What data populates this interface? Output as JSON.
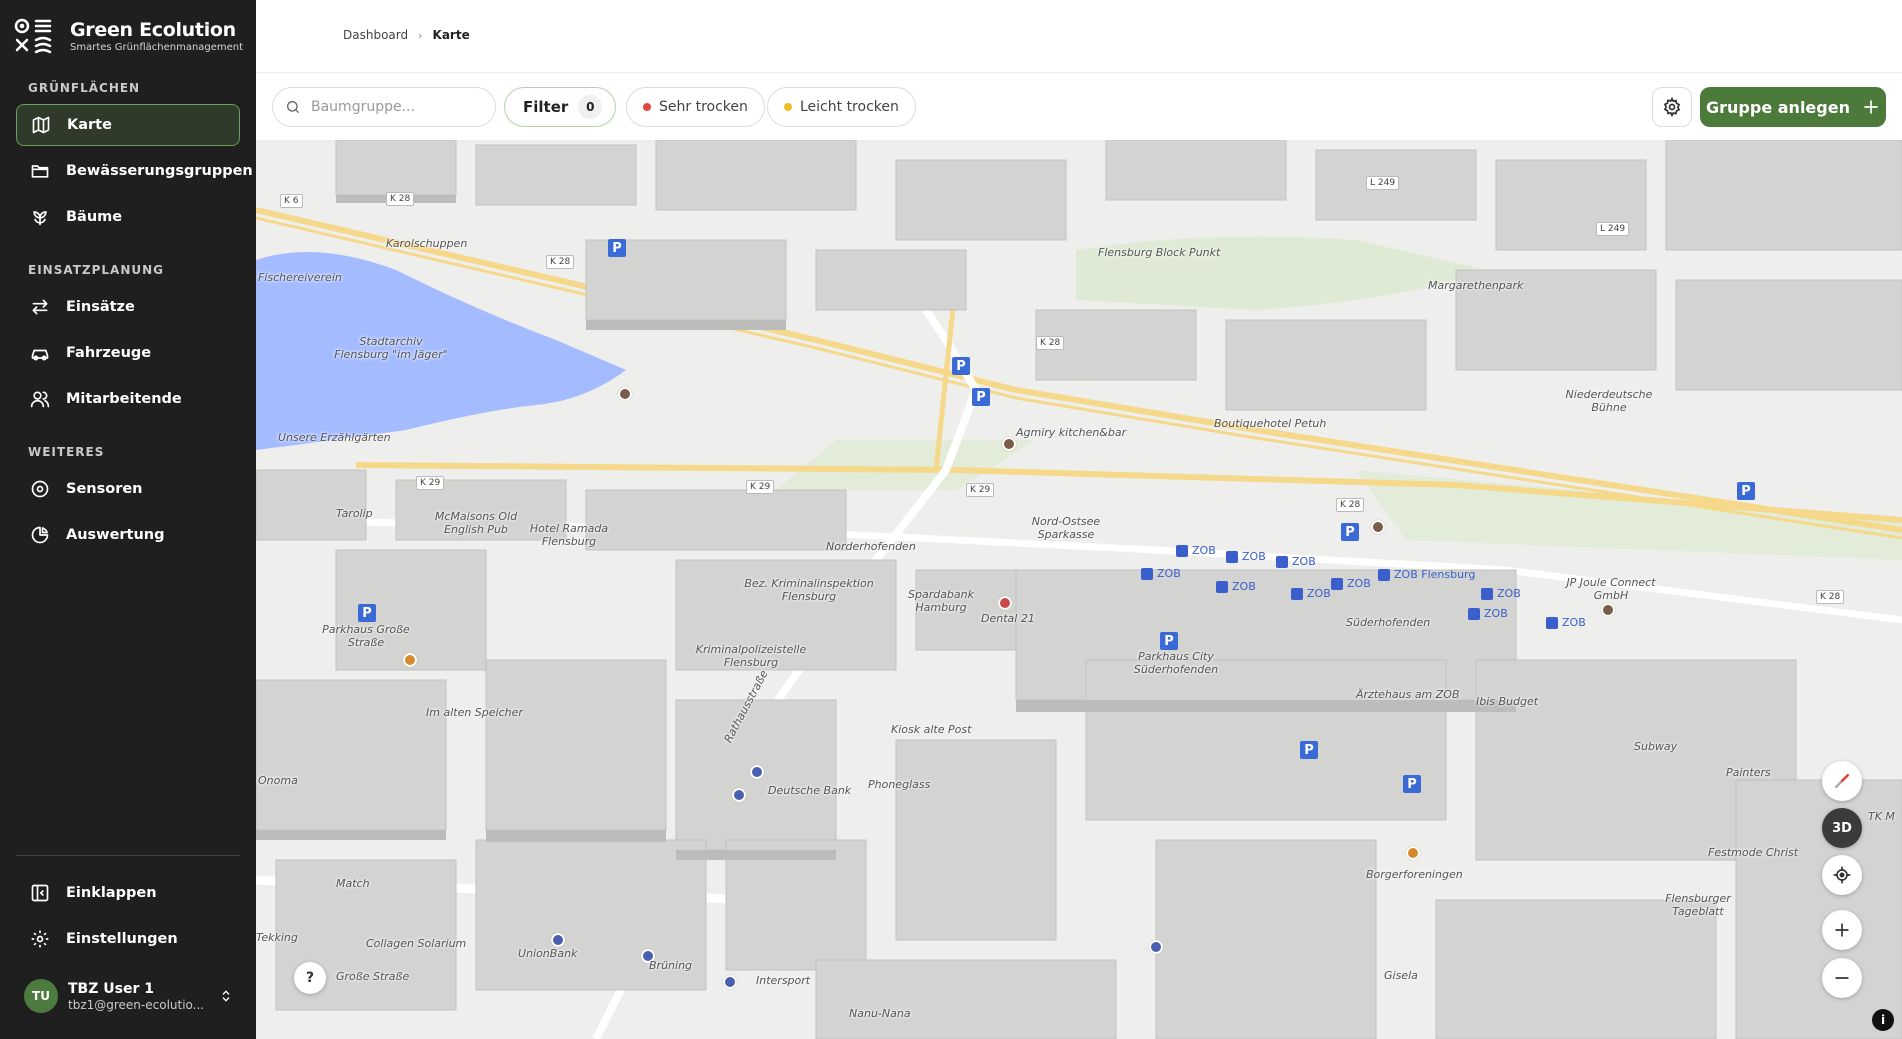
{
  "brand": {
    "title": "Green Ecolution",
    "subtitle": "Smartes Grünflächenmanagement"
  },
  "sidebar": {
    "sections": [
      {
        "label": "GRÜNFLÄCHEN",
        "items": [
          {
            "label": "Karte",
            "icon": "map-icon",
            "active": true
          },
          {
            "label": "Bewässerungsgruppen",
            "icon": "folder-icon"
          },
          {
            "label": "Bäume",
            "icon": "tree-icon"
          }
        ]
      },
      {
        "label": "EINSATZPLANUNG",
        "items": [
          {
            "label": "Einsätze",
            "icon": "arrows-exchange-icon"
          },
          {
            "label": "Fahrzeuge",
            "icon": "car-icon"
          },
          {
            "label": "Mitarbeitende",
            "icon": "users-icon"
          }
        ]
      },
      {
        "label": "WEITERES",
        "items": [
          {
            "label": "Sensoren",
            "icon": "sensor-icon"
          },
          {
            "label": "Auswertung",
            "icon": "pie-chart-icon"
          }
        ]
      }
    ],
    "bottom": {
      "collapse": "Einklappen",
      "settings": "Einstellungen"
    },
    "user": {
      "initials": "TU",
      "name": "TBZ User 1",
      "email": "tbz1@green-ecolutio..."
    }
  },
  "breadcrumb": {
    "parent": "Dashboard",
    "current": "Karte"
  },
  "filters": {
    "search_placeholder": "Baumgruppe...",
    "filter_label": "Filter",
    "filter_count": "0",
    "chips": [
      {
        "label": "Sehr trocken",
        "color": "#e0463d"
      },
      {
        "label": "Leicht trocken",
        "color": "#f2b922"
      }
    ],
    "create_label": "Gruppe anlegen"
  },
  "map": {
    "labels": [
      "Karolschuppen",
      "Stadtarchiv Flensburg \"im Jäger\"",
      "Fischereiverein",
      "Unsere Erzählgärten",
      "Tarolip",
      "McMaisons Old English Pub",
      "Hotel Ramada Flensburg",
      "Parkhaus Große Straße",
      "Bez. Kriminalinspektion Flensburg",
      "Kriminalpolizeistelle Flensburg",
      "Im alten Speicher",
      "Onoma",
      "Match",
      "Collagen Solarium",
      "UnionBank",
      "Brüning",
      "Intersport",
      "Nanu-Nana",
      "Kiosk alte Post",
      "Phoneglass",
      "Deutsche Bank",
      "Spardabank Hamburg",
      "Dental 21",
      "Nord-Ostsee Sparkasse",
      "Agmiry kitchen&bar",
      "Boutiquehotel Petuh",
      "Flensburg Block Punkt",
      "Margarethenpark",
      "Niederdeutsche Bühne",
      "Parkhaus City Süderhofenden",
      "Ärztehaus am ZOB",
      "Ibis Budget",
      "Subway",
      "Painters",
      "Festmode Christ",
      "Borgerforeningen",
      "Gisela",
      "Flensburger Tageblatt",
      "JP Joule Connect GmbH",
      "Große Straße",
      "Rathausstraße",
      "Süderhofenden",
      "Norderhofenden",
      "Tekking",
      "TK M"
    ],
    "zob": [
      "ZOB",
      "ZOB",
      "ZOB",
      "ZOB",
      "ZOB",
      "ZOB",
      "ZOB Flensburg",
      "ZOB",
      "ZOB",
      "ZOB",
      "ZOB"
    ],
    "roads": [
      "K 28",
      "K 29",
      "K 6",
      "L 249"
    ],
    "controls": {
      "mode_3d": "3D",
      "help": "?",
      "info": "i"
    }
  }
}
